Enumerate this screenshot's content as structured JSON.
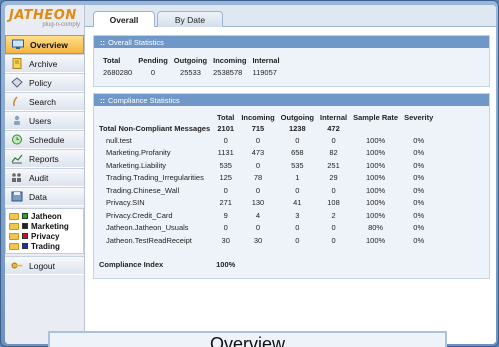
{
  "brand": {
    "logo": "JATHEON",
    "tagline": "plug-n-comply"
  },
  "nav": [
    {
      "label": "Overview",
      "icon": "overview-icon",
      "active": true
    },
    {
      "label": "Archive",
      "icon": "archive-icon"
    },
    {
      "label": "Policy",
      "icon": "policy-icon"
    },
    {
      "label": "Search",
      "icon": "search-icon"
    },
    {
      "label": "Users",
      "icon": "users-icon"
    },
    {
      "label": "Schedule",
      "icon": "schedule-icon"
    },
    {
      "label": "Reports",
      "icon": "reports-icon"
    },
    {
      "label": "Audit",
      "icon": "audit-icon"
    },
    {
      "label": "Data",
      "icon": "data-icon"
    }
  ],
  "folders": [
    {
      "label": "Jatheon",
      "color": "#2fa52f"
    },
    {
      "label": "Marketing",
      "color": "#222222"
    },
    {
      "label": "Privacy",
      "color": "#c8102e"
    },
    {
      "label": "Trading",
      "color": "#1f2fa8"
    }
  ],
  "logout": {
    "label": "Logout"
  },
  "tabs": [
    {
      "label": "Overall",
      "active": true
    },
    {
      "label": "By Date",
      "active": false
    }
  ],
  "overall": {
    "title": "Overall Statistics",
    "headers": [
      "Total",
      "Pending",
      "Outgoing",
      "Incoming",
      "Internal"
    ],
    "values": [
      "2680280",
      "0",
      "25533",
      "2538578",
      "119057"
    ]
  },
  "compliance": {
    "title": "Compliance Statistics",
    "headers": [
      "Total",
      "Incoming",
      "Outgoing",
      "Internal",
      "Sample Rate",
      "Severity"
    ],
    "total_row": {
      "label": "Total Non-Compliant Messages",
      "values": [
        "2101",
        "715",
        "1238",
        "472"
      ]
    },
    "rows": [
      {
        "name": "null.test",
        "values": [
          "0",
          "0",
          "0",
          "0",
          "100%",
          "0%"
        ]
      },
      {
        "name": "Marketing.Profanity",
        "values": [
          "1131",
          "473",
          "658",
          "82",
          "100%",
          "0%"
        ]
      },
      {
        "name": "Marketing.Liability",
        "values": [
          "535",
          "0",
          "535",
          "251",
          "100%",
          "0%"
        ]
      },
      {
        "name": "Trading.Trading_Irregularities",
        "values": [
          "125",
          "78",
          "1",
          "29",
          "100%",
          "0%"
        ]
      },
      {
        "name": "Trading.Chinese_Wall",
        "values": [
          "0",
          "0",
          "0",
          "0",
          "100%",
          "0%"
        ]
      },
      {
        "name": "Privacy.SIN",
        "values": [
          "271",
          "130",
          "41",
          "108",
          "100%",
          "0%"
        ]
      },
      {
        "name": "Privacy.Credit_Card",
        "values": [
          "9",
          "4",
          "3",
          "2",
          "100%",
          "0%"
        ]
      },
      {
        "name": "Jatheon.Jatheon_Usuals",
        "values": [
          "0",
          "0",
          "0",
          "0",
          "80%",
          "0%"
        ]
      },
      {
        "name": "Jatheon.TestReadReceipt",
        "values": [
          "30",
          "30",
          "0",
          "0",
          "100%",
          "0%"
        ]
      }
    ],
    "index_label": "Compliance Index",
    "index_value": "100%"
  },
  "caption": "Overview"
}
